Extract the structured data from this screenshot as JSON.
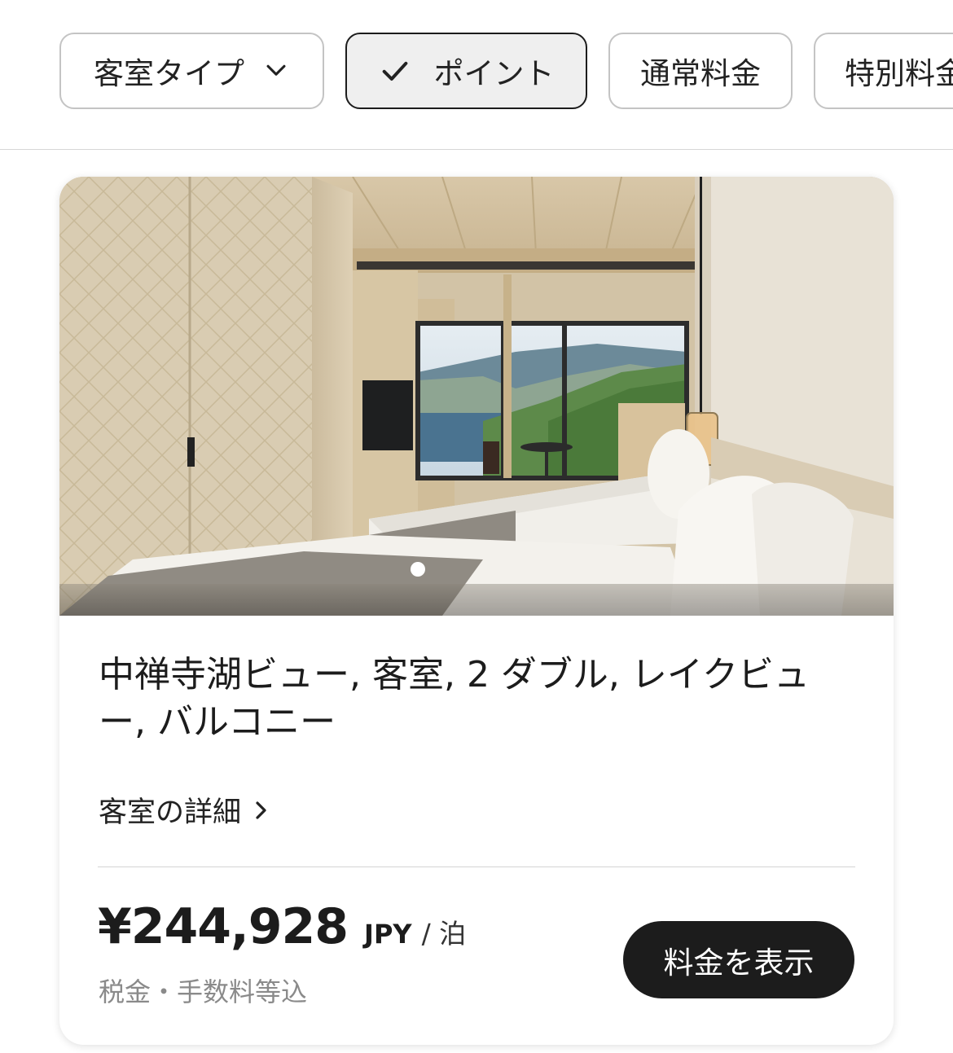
{
  "filters": {
    "room_type": {
      "label": "客室タイプ",
      "icon": "chevron-down-icon"
    },
    "points": {
      "label": "ポイント",
      "selected": true,
      "icon": "check-icon"
    },
    "regular_rate": {
      "label": "通常料金"
    },
    "special_rate": {
      "label": "特別料金"
    }
  },
  "room": {
    "photo_icon": "hotel-room-photo",
    "carousel_dots": 1,
    "title": "中禅寺湖ビュー, 客室, 2 ダブル, レイクビュー, バルコニー",
    "details_link": "客室の詳細",
    "price": "¥244,928",
    "currency": "JPY",
    "per_night": "/ 泊",
    "tax_note": "税金・手数料等込",
    "cta": "料金を表示"
  },
  "colors": {
    "button_dark": "#1c1c1c",
    "selected_chip_bg": "#efefef"
  }
}
